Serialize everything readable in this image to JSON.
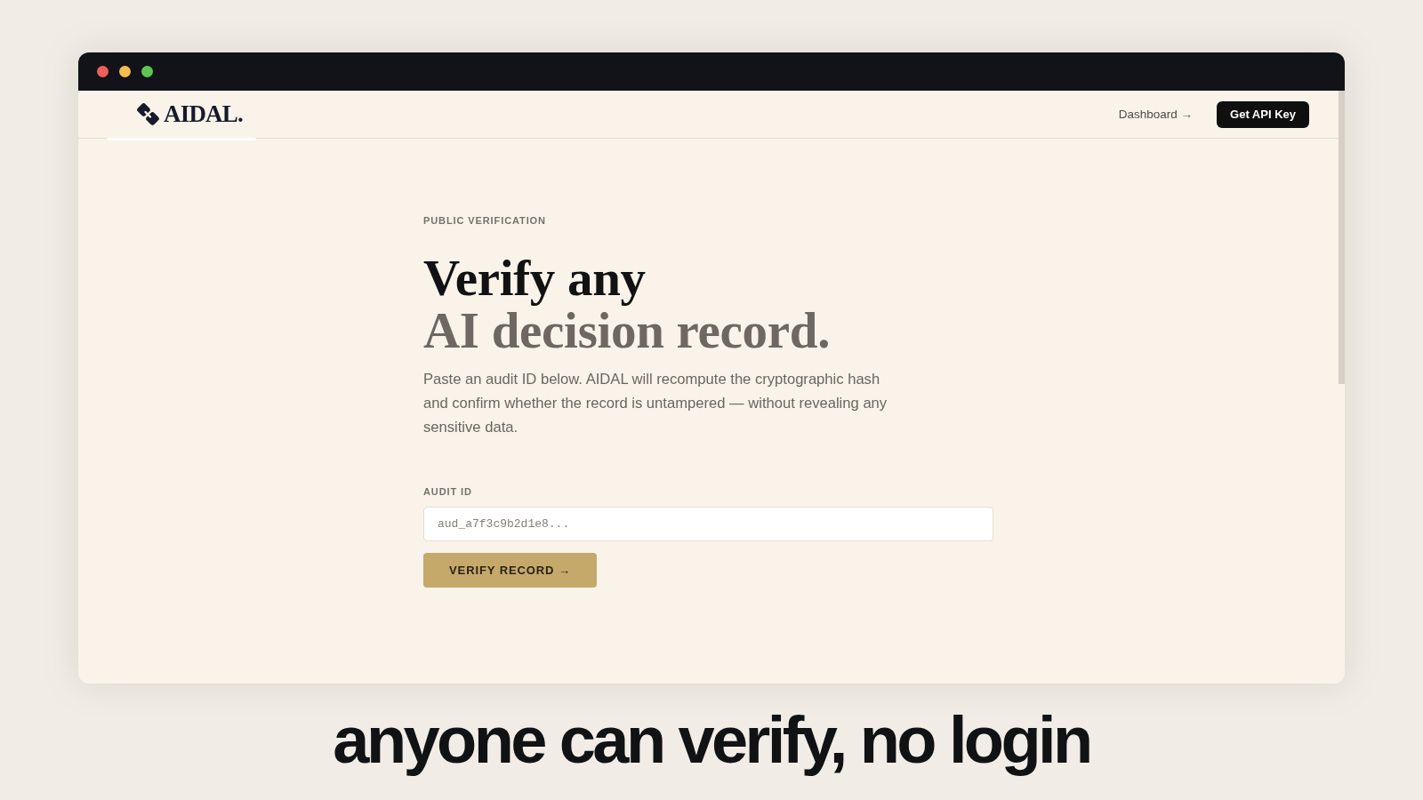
{
  "nav": {
    "logo": "AIDAL.",
    "link": "Dashboard →",
    "cta": "Get API Key"
  },
  "hero": {
    "eyebrow": "PUBLIC VERIFICATION",
    "title_line_1": "Verify any",
    "title_line_2": "AI decision record.",
    "description": "Paste an audit ID below. AIDAL will recompute the cryptographic hash and confirm whether the record is untampered — without revealing any sensitive data."
  },
  "form": {
    "label": "AUDIT ID",
    "placeholder": "aud_a7f3c9b2d1e8...",
    "button": "VERIFY RECORD →"
  },
  "caption": "anyone can verify, no login"
}
